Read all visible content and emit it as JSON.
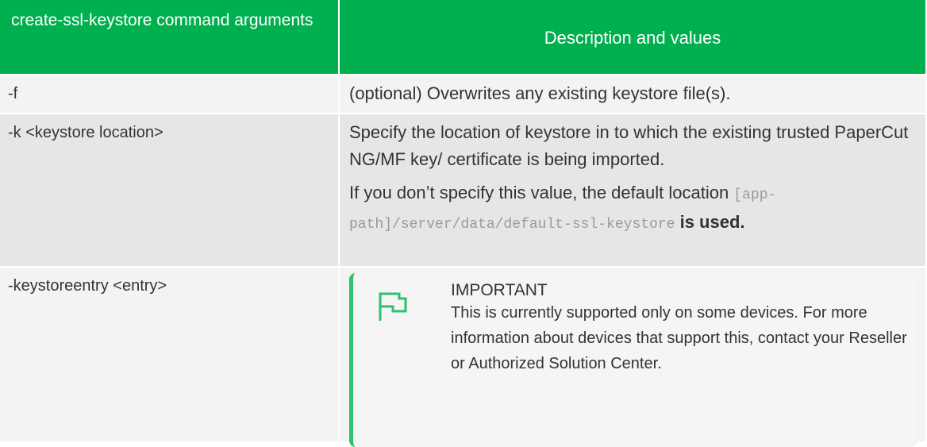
{
  "table": {
    "headers": [
      "create-ssl-keystore command arguments",
      "Description and values"
    ],
    "rows": [
      {
        "argument": "-f",
        "description": "(optional) Overwrites any existing keystore file(s)."
      },
      {
        "argument": "-k <keystore location>",
        "description": "Specify the location of keystore in to which the existing trusted PaperCut NG/MF key/ certificate is being imported.",
        "description_2_before": "If you don’t specify this value, the default location ",
        "description_2_code": "[app-path]/server/data/default-ssl-keystore",
        "description_2_after": " is used."
      },
      {
        "argument": "-keystoreentry <entry>",
        "note": {
          "icon": "flag-icon",
          "title": "IMPORTANT",
          "body": "This is currently supported only on some devices. For more information about devices that support this, contact your Reseller or Authorized Solution Center."
        }
      }
    ]
  },
  "colors": {
    "header_bg": "#00b04f",
    "accent": "#2fc16b",
    "row_light": "#f3f3f3",
    "row_dark": "#e6e6e6"
  }
}
